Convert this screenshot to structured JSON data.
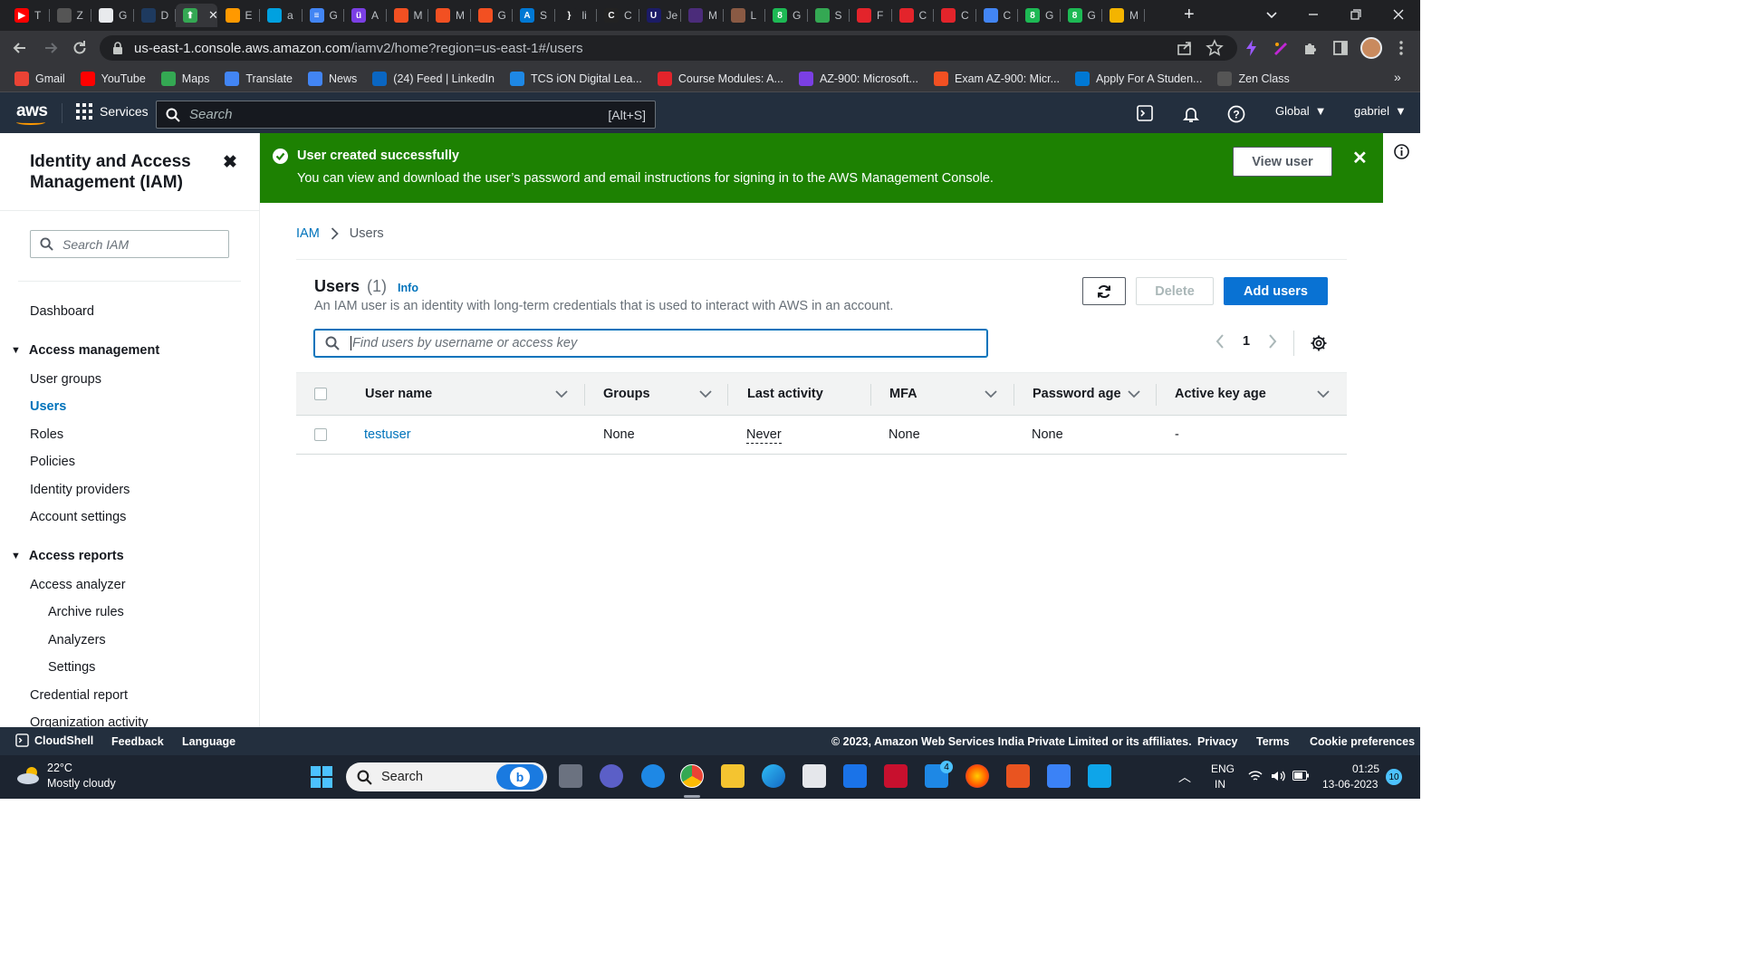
{
  "browser": {
    "tabs": [
      {
        "label": "T",
        "fav": "#ff0000",
        "glyph": "▶"
      },
      {
        "label": "Z",
        "fav": "#555",
        "glyph": ""
      },
      {
        "label": "G",
        "fav": "#e8eaed",
        "glyph": ""
      },
      {
        "label": "D",
        "fav": "#1e3a5f",
        "glyph": ""
      },
      {
        "label": "",
        "fav": "#34a853",
        "glyph": "⬆",
        "active": true
      },
      {
        "label": "E",
        "fav": "#ff9900",
        "glyph": ""
      },
      {
        "label": "a",
        "fav": "#00a1e0",
        "glyph": ""
      },
      {
        "label": "G",
        "fav": "#4285f4",
        "glyph": "≡"
      },
      {
        "label": "A",
        "fav": "#7b3fe4",
        "glyph": "ü"
      },
      {
        "label": "M",
        "fav": "#f25022",
        "glyph": ""
      },
      {
        "label": "M",
        "fav": "#f25022",
        "glyph": ""
      },
      {
        "label": "G",
        "fav": "#f25022",
        "glyph": ""
      },
      {
        "label": "S",
        "fav": "#0078d4",
        "glyph": "A"
      },
      {
        "label": "li",
        "fav": "#202124",
        "glyph": "}"
      },
      {
        "label": "C",
        "fav": "#222",
        "glyph": "C"
      },
      {
        "label": "Je",
        "fav": "#1b1b66",
        "glyph": "U"
      },
      {
        "label": "M",
        "fav": "#4b2c7a",
        "glyph": ""
      },
      {
        "label": "L",
        "fav": "#8a5a44",
        "glyph": ""
      },
      {
        "label": "G",
        "fav": "#1db954",
        "glyph": "8"
      },
      {
        "label": "S",
        "fav": "#34a853",
        "glyph": ""
      },
      {
        "label": "F",
        "fav": "#e3242b",
        "glyph": ""
      },
      {
        "label": "C",
        "fav": "#e3242b",
        "glyph": ""
      },
      {
        "label": "C",
        "fav": "#e3242b",
        "glyph": ""
      },
      {
        "label": "C",
        "fav": "#4285f4",
        "glyph": ""
      },
      {
        "label": "G",
        "fav": "#1db954",
        "glyph": "8"
      },
      {
        "label": "G",
        "fav": "#1db954",
        "glyph": "8"
      },
      {
        "label": "M",
        "fav": "#f4b400",
        "glyph": ""
      }
    ],
    "active_tab_close": "✕",
    "new_tab": "+",
    "url_host": "us-east-1.console.aws.amazon.com",
    "url_path": "/iamv2/home?region=us-east-1#/users"
  },
  "bookmarks": [
    {
      "label": "Gmail",
      "color": "#ea4335"
    },
    {
      "label": "YouTube",
      "color": "#ff0000"
    },
    {
      "label": "Maps",
      "color": "#34a853"
    },
    {
      "label": "Translate",
      "color": "#4285f4"
    },
    {
      "label": "News",
      "color": "#4285f4"
    },
    {
      "label": "(24) Feed | LinkedIn",
      "color": "#0a66c2"
    },
    {
      "label": "TCS iON Digital Lea...",
      "color": "#1e88e5"
    },
    {
      "label": "Course Modules: A...",
      "color": "#e3242b"
    },
    {
      "label": "AZ-900: Microsoft...",
      "color": "#7b3fe4"
    },
    {
      "label": "Exam AZ-900: Micr...",
      "color": "#f25022"
    },
    {
      "label": "Apply For A Studen...",
      "color": "#0078d4"
    },
    {
      "label": "Zen Class",
      "color": "#555"
    }
  ],
  "bookmarks_more": "»",
  "aws": {
    "logo": "aws",
    "services": "Services",
    "search_placeholder": "Search",
    "search_shortcut": "[Alt+S]",
    "region": "Global",
    "user": "gabriel"
  },
  "sidebar": {
    "title": "Identity and Access Management (IAM)",
    "close": "✖",
    "search_placeholder": "Search IAM",
    "dashboard": "Dashboard",
    "access_management": "Access management",
    "user_groups": "User groups",
    "users": "Users",
    "roles": "Roles",
    "policies": "Policies",
    "identity_providers": "Identity providers",
    "account_settings": "Account settings",
    "access_reports": "Access reports",
    "access_analyzer": "Access analyzer",
    "archive_rules": "Archive rules",
    "analyzers": "Analyzers",
    "settings": "Settings",
    "credential_report": "Credential report",
    "organization_activity": "Organization activity"
  },
  "flash": {
    "heading": "User created successfully",
    "message": "You can view and download the user’s password and email instructions for signing in to the AWS Management Console.",
    "view_user": "View user",
    "close": "✕",
    "color": "#1d8102"
  },
  "breadcrumb": {
    "root": "IAM",
    "sep": "›",
    "current": "Users"
  },
  "users_panel": {
    "title": "Users",
    "count": "(1)",
    "info": "Info",
    "description": "An IAM user is an identity with long-term credentials that is used to interact with AWS in an account.",
    "delete": "Delete",
    "add_users": "Add users",
    "search_placeholder": "Find users by username or access key",
    "page": "1",
    "columns": [
      "User name",
      "Groups",
      "Last activity",
      "MFA",
      "Password age",
      "Active key age"
    ],
    "rows": [
      {
        "user_name": "testuser",
        "groups": "None",
        "last_activity": "Never",
        "mfa": "None",
        "password_age": "None",
        "active_key_age": "-"
      }
    ]
  },
  "footer": {
    "cloudshell": "CloudShell",
    "feedback": "Feedback",
    "language": "Language",
    "copyright": "© 2023, Amazon Web Services India Private Limited or its affiliates.",
    "privacy": "Privacy",
    "terms": "Terms",
    "cookie": "Cookie preferences"
  },
  "taskbar": {
    "temp": "22°C",
    "weather": "Mostly cloudy",
    "search": "Search",
    "lang1": "ENG",
    "lang2": "IN",
    "time": "01:25",
    "date": "13-06-2023",
    "notifications": "10",
    "mail_badge": "4"
  }
}
